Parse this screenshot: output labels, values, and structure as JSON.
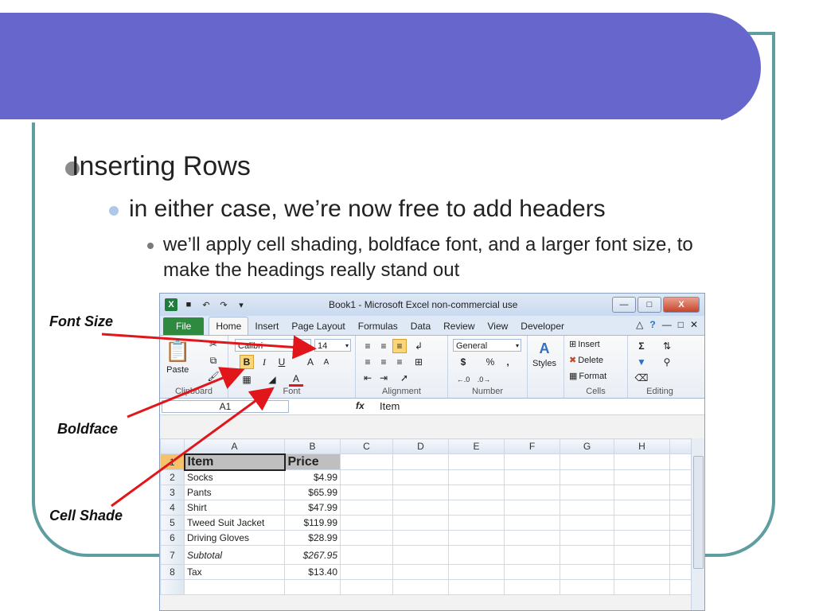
{
  "slide": {
    "bullet1": "Inserting Rows",
    "bullet2": "in either case, we’re now free to add headers",
    "bullet3": "we’ll apply cell shading, boldface font, and a larger font size, to make the headings really stand out"
  },
  "annotations": {
    "font_size": "Font Size",
    "boldface": "Boldface",
    "cell_shade": "Cell Shade"
  },
  "colors": {
    "banner": "#6666cc",
    "frame": "#5f9ea0",
    "arrow": "#e0161b",
    "header_shade": "#bfbfbf",
    "file_tab": "#2e8a3f"
  },
  "excel": {
    "title": "Book1  -  Microsoft Excel non-commercial use",
    "tabs": [
      "File",
      "Home",
      "Insert",
      "Page Layout",
      "Formulas",
      "Data",
      "Review",
      "View",
      "Developer"
    ],
    "ribbon": {
      "paste": "Paste",
      "clipboard": "Clipboard",
      "font_name": "Calibri",
      "font_size": "14",
      "bold": "B",
      "italic": "I",
      "underline": "U",
      "grow": "A",
      "shrink": "A",
      "font_color": "A",
      "font": "Font",
      "alignment": "Alignment",
      "number_format": "General",
      "currency": "$",
      "percent": "%",
      "comma": ",",
      "number": "Number",
      "styles": "Styles",
      "insert": "Insert",
      "delete": "Delete",
      "format": "Format",
      "cells": "Cells",
      "sigma": "Σ",
      "editing": "Editing"
    },
    "name_box": "A1",
    "fx": "fx",
    "formula_value": "Item",
    "columns": [
      "A",
      "B",
      "C",
      "D",
      "E",
      "F",
      "G",
      "H"
    ],
    "rows": [
      {
        "n": "1",
        "a": "Item",
        "b": "Price"
      },
      {
        "n": "2",
        "a": "Socks",
        "b": "$4.99"
      },
      {
        "n": "3",
        "a": "Pants",
        "b": "$65.99"
      },
      {
        "n": "4",
        "a": "Shirt",
        "b": "$47.99"
      },
      {
        "n": "5",
        "a": "Tweed Suit Jacket",
        "b": "$119.99"
      },
      {
        "n": "6",
        "a": "Driving Gloves",
        "b": "$28.99"
      },
      {
        "n": "7",
        "a": "Subtotal",
        "b": "$267.95"
      },
      {
        "n": "8",
        "a": "Tax",
        "b": "$13.40"
      }
    ]
  }
}
